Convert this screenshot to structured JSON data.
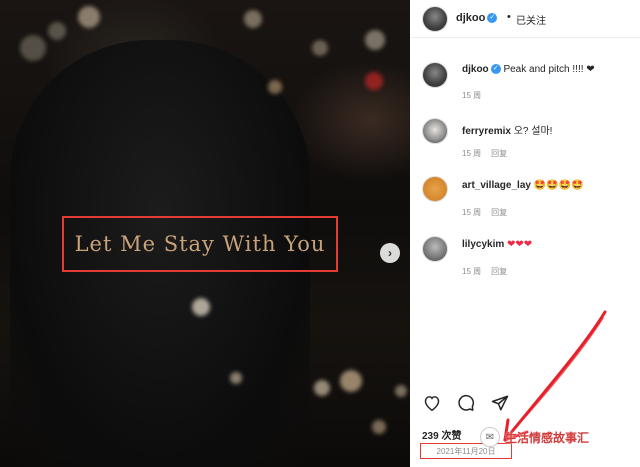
{
  "post": {
    "overlay_text": "Let Me Stay With You"
  },
  "header": {
    "username": "djkoo",
    "separator": "•",
    "follow_label": "已关注"
  },
  "comments": [
    {
      "username": "djkoo",
      "text": "Peak and pitch !!!! ❤",
      "time": "15 周",
      "reply": ""
    },
    {
      "username": "ferryremix",
      "text": "오? 설마!",
      "time": "15 周",
      "reply": "回复"
    },
    {
      "username": "art_village_lay",
      "text": "🤩🤩🤩🤩",
      "time": "15 周",
      "reply": "回复"
    },
    {
      "username": "lilycykim",
      "text": "❤❤❤",
      "time": "15 周",
      "reply": "回复"
    }
  ],
  "likes": "239 次赞",
  "date": "2021年11月20日",
  "watermark": "生活情感故事汇",
  "colors": {
    "annotation_red": "#e53b33",
    "verified_blue": "#3897f0",
    "heart_red": "#ed2b46"
  },
  "icons": [
    "heart-icon",
    "comment-icon",
    "share-icon",
    "next-arrow-icon",
    "verified-icon"
  ]
}
